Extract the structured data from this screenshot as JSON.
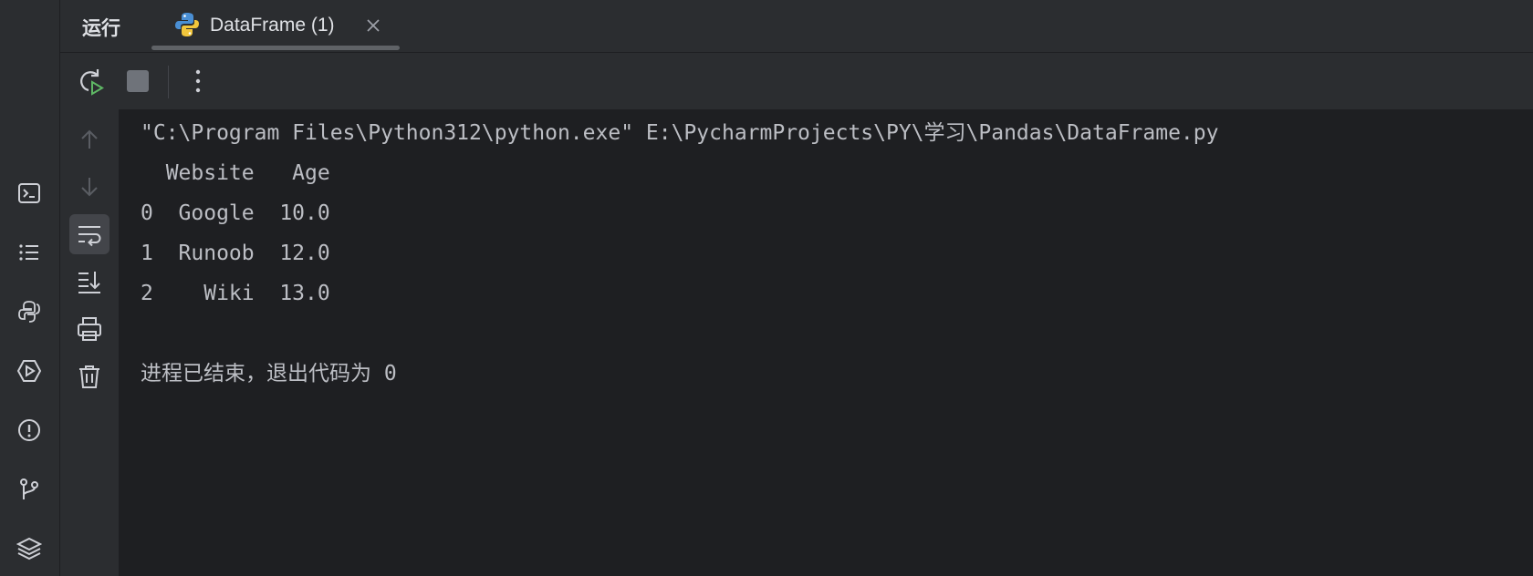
{
  "tool_window": {
    "title": "运行",
    "tab": {
      "label": "DataFrame (1)",
      "icon": "python-icon"
    }
  },
  "toolbar": {
    "rerun_icon": "rerun-icon",
    "stop_icon": "stop-icon",
    "more_icon": "more-vertical-icon"
  },
  "left_strip_icons": [
    "terminal-icon",
    "structure-list-icon",
    "python-console-icon",
    "services-icon",
    "problems-icon",
    "git-icon",
    "layers-icon"
  ],
  "gutter_icons": [
    "arrow-up-icon",
    "arrow-down-icon",
    "soft-wrap-icon",
    "scroll-to-end-icon",
    "print-icon",
    "trash-icon"
  ],
  "console": {
    "command": "\"C:\\Program Files\\Python312\\python.exe\" E:\\PycharmProjects\\PY\\学习\\Pandas\\DataFrame.py",
    "header": "  Website   Age",
    "rows": [
      "0  Google  10.0",
      "1  Runoob  12.0",
      "2    Wiki  13.0"
    ],
    "exit_message": "进程已结束，退出代码为 0"
  },
  "colors": {
    "background": "#1e1f22",
    "panel": "#2b2d30",
    "text": "#bcbec4",
    "run_green": "#5fb865"
  }
}
